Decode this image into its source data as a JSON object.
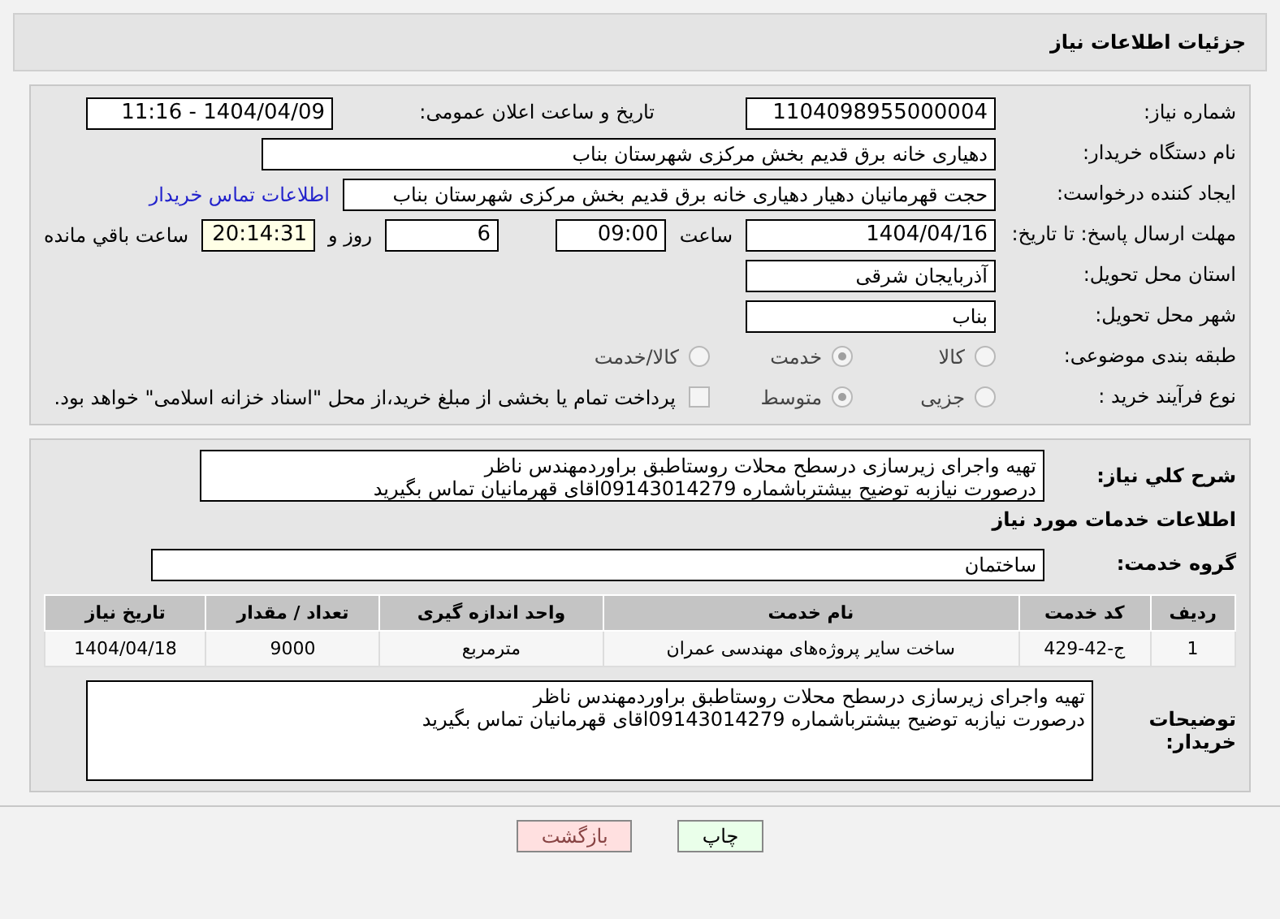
{
  "header": {
    "title": "جزئیات اطلاعات نیاز"
  },
  "details": {
    "need_number": {
      "label": "شماره نیاز:",
      "value": "1104098955000004"
    },
    "announce": {
      "label": "تاریخ و ساعت اعلان عمومی:",
      "value": "1404/04/09 - 11:16"
    },
    "buyer": {
      "label": "نام دستگاه خریدار:",
      "value": "دهیاری خانه برق قدیم بخش مرکزی شهرستان بناب"
    },
    "creator": {
      "label": "ایجاد کننده درخواست:",
      "value": "حجت قهرمانیان دهیار دهیاری خانه برق قدیم بخش مرکزی شهرستان بناب",
      "link": "اطلاعات تماس خریدار"
    },
    "deadline": {
      "label": "مهلت ارسال پاسخ: تا تاریخ:",
      "date": "1404/04/16",
      "time_label": "ساعت",
      "time": "09:00",
      "days": "6",
      "days_label": "روز و",
      "remaining": "20:14:31",
      "remaining_label": "ساعت باقي مانده"
    },
    "province": {
      "label": "استان محل تحویل:",
      "value": "آذربایجان شرقی"
    },
    "city": {
      "label": "شهر محل تحویل:",
      "value": "بناب"
    },
    "category": {
      "label": "طبقه بندی موضوعی:",
      "options": [
        {
          "label": "کالا",
          "selected": false
        },
        {
          "label": "خدمت",
          "selected": true
        },
        {
          "label": "کالا/خدمت",
          "selected": false
        }
      ]
    },
    "process": {
      "label": "نوع فرآیند خرید :",
      "options": [
        {
          "label": "جزیی",
          "selected": false
        },
        {
          "label": "متوسط",
          "selected": true
        }
      ],
      "payment": {
        "checked": false,
        "text": "پرداخت تمام یا بخشی از مبلغ خرید،از محل \"اسناد خزانه اسلامی\" خواهد بود."
      }
    }
  },
  "summary": {
    "label": "شرح کلي نياز:",
    "value": "تهیه واجرای زیرسازی درسطح محلات روستاطبق براوردمهندس ناظر\nدرصورت نیازبه توضیح بیشترباشماره 09143014279اقای قهرمانیان تماس بگیرید"
  },
  "services_title": "اطلاعات خدمات مورد نیاز",
  "service_group": {
    "label": "گروه خدمت:",
    "value": "ساختمان"
  },
  "table": {
    "columns": [
      "ردیف",
      "کد خدمت",
      "نام خدمت",
      "واحد اندازه گیری",
      "تعداد / مقدار",
      "تاریخ نیاز"
    ],
    "rows": [
      [
        "1",
        "ج-42-429",
        "ساخت سایر پروژه‌های مهندسی عمران",
        "مترمربع",
        "9000",
        "1404/04/18"
      ]
    ]
  },
  "buyer_notes": {
    "label": "توضیحات خریدار:",
    "value": "تهیه واجرای زیرسازی درسطح محلات روستاطبق براوردمهندس ناظر\nدرصورت نیازبه توضیح بیشترباشماره 09143014279اقای قهرمانیان تماس بگیرید"
  },
  "buttons": [
    {
      "kind": "print",
      "label": "چاپ"
    },
    {
      "kind": "back",
      "label": "بازگشت"
    }
  ]
}
